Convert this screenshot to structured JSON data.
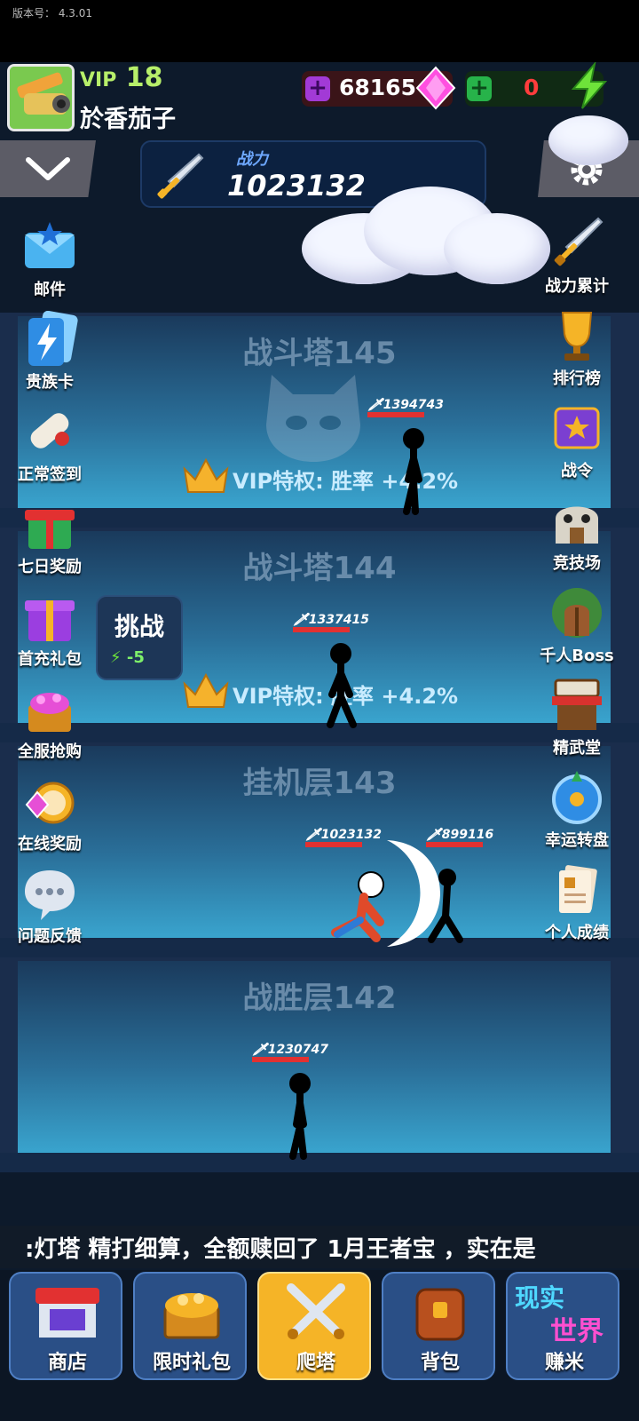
{
  "version_text": "版本号：  4.3.01",
  "profile": {
    "vip_label": "VIP",
    "vip_level": "18",
    "username": "於香茄子"
  },
  "currency": {
    "gems": "68165",
    "energy": "0"
  },
  "power": {
    "label": "战力",
    "value": "1023132"
  },
  "left_menu": [
    {
      "label": "邮件",
      "icon": "mail-icon"
    },
    {
      "label": "贵族卡",
      "icon": "noble-card-icon"
    },
    {
      "label": "正常签到",
      "icon": "scroll-icon"
    },
    {
      "label": "七日奖励",
      "icon": "gift-icon"
    },
    {
      "label": "首充礼包",
      "icon": "giftbox-icon"
    },
    {
      "label": "全服抢购",
      "icon": "treasure-icon"
    },
    {
      "label": "在线奖励",
      "icon": "stopwatch-icon"
    },
    {
      "label": "问题反馈",
      "icon": "chat-icon"
    }
  ],
  "right_menu": [
    {
      "label": "战力累计",
      "icon": "sword-icon"
    },
    {
      "label": "排行榜",
      "icon": "trophy-icon"
    },
    {
      "label": "战令",
      "icon": "book-icon"
    },
    {
      "label": "竞技场",
      "icon": "arena-icon"
    },
    {
      "label": "千人Boss",
      "icon": "boss-door-icon"
    },
    {
      "label": "精武堂",
      "icon": "dojo-icon"
    },
    {
      "label": "幸运转盘",
      "icon": "wheel-icon"
    },
    {
      "label": "个人成绩",
      "icon": "report-icon"
    }
  ],
  "floors": [
    {
      "title": "战斗塔145",
      "vip": "VIP特权: 胜率 +4.2%",
      "enemy_power": "1394743"
    },
    {
      "title": "战斗塔144",
      "vip": "VIP特权: 胜率 +4.2%",
      "enemy_power": "1337415"
    },
    {
      "title": "挂机层143",
      "player_power": "1023132",
      "enemy_power": "899116"
    },
    {
      "title": "战胜层142",
      "enemy_power": "1230747"
    }
  ],
  "challenge": {
    "label": "挑战",
    "cost": "-5"
  },
  "ticker": ":灯塔 精打细算，全额赎回了 1月王者宝 ，实在是",
  "bottom_nav": [
    {
      "label": "商店",
      "icon": "shop-icon"
    },
    {
      "label": "限时礼包",
      "icon": "chest-icon"
    },
    {
      "label": "爬塔",
      "icon": "crossed-swords-icon"
    },
    {
      "label": "背包",
      "icon": "backpack-icon"
    },
    {
      "label": "赚米",
      "icon": "real-world-icon",
      "badge_top": "现实",
      "badge_bottom": "世界"
    }
  ],
  "colors": {
    "accent_gold": "#f5b427",
    "vip_green": "#b7ef6a",
    "hp_red": "#e23131"
  }
}
